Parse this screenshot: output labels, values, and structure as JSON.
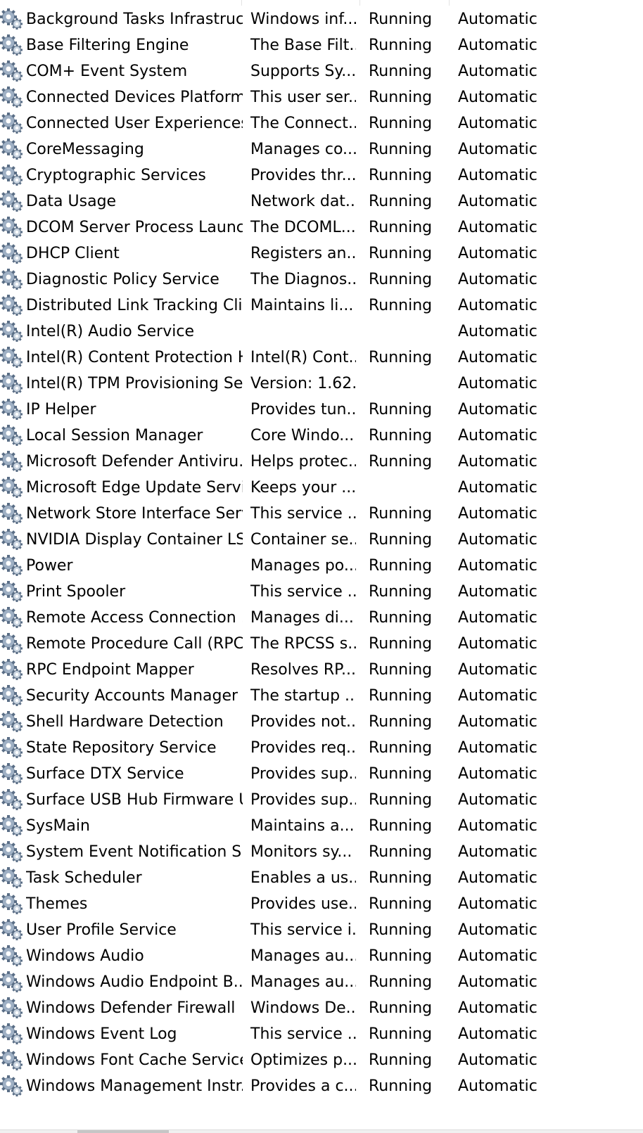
{
  "services": [
    {
      "name": "Background Tasks Infrastruc...",
      "description": "Windows inf...",
      "status": "Running",
      "startup_type": "Automatic"
    },
    {
      "name": "Base Filtering Engine",
      "description": "The Base Filt...",
      "status": "Running",
      "startup_type": "Automatic"
    },
    {
      "name": "COM+ Event System",
      "description": "Supports Sy...",
      "status": "Running",
      "startup_type": "Automatic"
    },
    {
      "name": "Connected Devices Platform ...",
      "description": "This user ser...",
      "status": "Running",
      "startup_type": "Automatic"
    },
    {
      "name": "Connected User Experiences ...",
      "description": "The Connect...",
      "status": "Running",
      "startup_type": "Automatic"
    },
    {
      "name": "CoreMessaging",
      "description": "Manages co...",
      "status": "Running",
      "startup_type": "Automatic"
    },
    {
      "name": "Cryptographic Services",
      "description": "Provides thr...",
      "status": "Running",
      "startup_type": "Automatic"
    },
    {
      "name": "Data Usage",
      "description": "Network dat...",
      "status": "Running",
      "startup_type": "Automatic"
    },
    {
      "name": "DCOM Server Process Launc...",
      "description": "The DCOML...",
      "status": "Running",
      "startup_type": "Automatic"
    },
    {
      "name": "DHCP Client",
      "description": "Registers an...",
      "status": "Running",
      "startup_type": "Automatic"
    },
    {
      "name": "Diagnostic Policy Service",
      "description": "The Diagnos...",
      "status": "Running",
      "startup_type": "Automatic"
    },
    {
      "name": "Distributed Link Tracking Cli...",
      "description": "Maintains li...",
      "status": "Running",
      "startup_type": "Automatic"
    },
    {
      "name": "Intel(R) Audio Service",
      "description": "",
      "status": "",
      "startup_type": "Automatic"
    },
    {
      "name": "Intel(R) Content Protection H...",
      "description": "Intel(R) Cont...",
      "status": "Running",
      "startup_type": "Automatic"
    },
    {
      "name": "Intel(R) TPM Provisioning Se...",
      "description": "Version: 1.62....",
      "status": "",
      "startup_type": "Automatic"
    },
    {
      "name": "IP Helper",
      "description": "Provides tun...",
      "status": "Running",
      "startup_type": "Automatic"
    },
    {
      "name": "Local Session Manager",
      "description": "Core Windo...",
      "status": "Running",
      "startup_type": "Automatic"
    },
    {
      "name": "Microsoft Defender Antiviru...",
      "description": "Helps protec...",
      "status": "Running",
      "startup_type": "Automatic"
    },
    {
      "name": "Microsoft Edge Update Servi...",
      "description": "Keeps your ...",
      "status": "",
      "startup_type": "Automatic"
    },
    {
      "name": "Network Store Interface Serv...",
      "description": "This service ...",
      "status": "Running",
      "startup_type": "Automatic"
    },
    {
      "name": "NVIDIA Display Container LS",
      "description": "Container se...",
      "status": "Running",
      "startup_type": "Automatic"
    },
    {
      "name": "Power",
      "description": "Manages po...",
      "status": "Running",
      "startup_type": "Automatic"
    },
    {
      "name": "Print Spooler",
      "description": "This service ...",
      "status": "Running",
      "startup_type": "Automatic"
    },
    {
      "name": "Remote Access Connection ...",
      "description": "Manages di...",
      "status": "Running",
      "startup_type": "Automatic"
    },
    {
      "name": "Remote Procedure Call (RPC)",
      "description": "The RPCSS s...",
      "status": "Running",
      "startup_type": "Automatic"
    },
    {
      "name": "RPC Endpoint Mapper",
      "description": "Resolves RP...",
      "status": "Running",
      "startup_type": "Automatic"
    },
    {
      "name": "Security Accounts Manager",
      "description": "The startup ...",
      "status": "Running",
      "startup_type": "Automatic"
    },
    {
      "name": "Shell Hardware Detection",
      "description": "Provides not...",
      "status": "Running",
      "startup_type": "Automatic"
    },
    {
      "name": "State Repository Service",
      "description": "Provides req...",
      "status": "Running",
      "startup_type": "Automatic"
    },
    {
      "name": "Surface DTX Service",
      "description": "Provides sup...",
      "status": "Running",
      "startup_type": "Automatic"
    },
    {
      "name": "Surface USB Hub Firmware U...",
      "description": "Provides sup...",
      "status": "Running",
      "startup_type": "Automatic"
    },
    {
      "name": "SysMain",
      "description": "Maintains a...",
      "status": "Running",
      "startup_type": "Automatic"
    },
    {
      "name": "System Event Notification S...",
      "description": "Monitors sy...",
      "status": "Running",
      "startup_type": "Automatic"
    },
    {
      "name": "Task Scheduler",
      "description": "Enables a us...",
      "status": "Running",
      "startup_type": "Automatic"
    },
    {
      "name": "Themes",
      "description": "Provides use...",
      "status": "Running",
      "startup_type": "Automatic"
    },
    {
      "name": "User Profile Service",
      "description": "This service i...",
      "status": "Running",
      "startup_type": "Automatic"
    },
    {
      "name": "Windows Audio",
      "description": "Manages au...",
      "status": "Running",
      "startup_type": "Automatic"
    },
    {
      "name": "Windows Audio Endpoint B...",
      "description": "Manages au...",
      "status": "Running",
      "startup_type": "Automatic"
    },
    {
      "name": "Windows Defender Firewall",
      "description": "Windows De...",
      "status": "Running",
      "startup_type": "Automatic"
    },
    {
      "name": "Windows Event Log",
      "description": "This service ...",
      "status": "Running",
      "startup_type": "Automatic"
    },
    {
      "name": "Windows Font Cache Service",
      "description": "Optimizes p...",
      "status": "Running",
      "startup_type": "Automatic"
    },
    {
      "name": "Windows Management Instr...",
      "description": "Provides a c...",
      "status": "Running",
      "startup_type": "Automatic"
    }
  ],
  "icons": {
    "service": "gear-icon"
  },
  "colors": {
    "text": "#000000",
    "background": "#ffffff",
    "gear_dark": "#5a6e86",
    "gear_light": "#c9d4e0"
  }
}
